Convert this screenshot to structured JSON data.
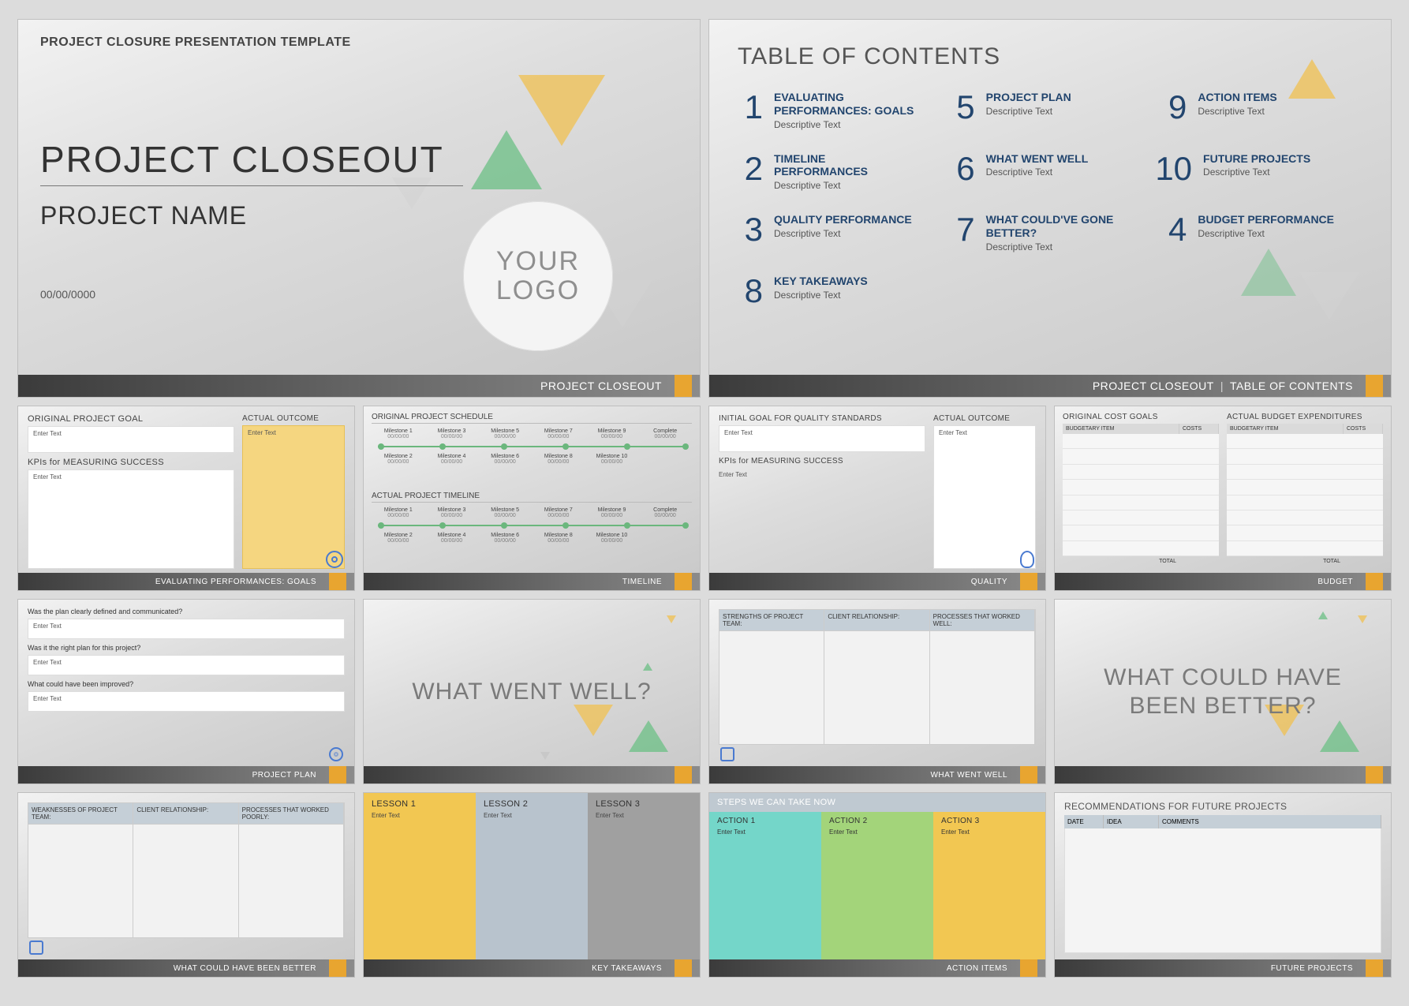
{
  "slide1": {
    "header": "PROJECT CLOSURE PRESENTATION TEMPLATE",
    "title": "PROJECT CLOSEOUT",
    "subtitle": "PROJECT NAME",
    "date": "00/00/0000",
    "logo": "YOUR LOGO",
    "footer": "PROJECT CLOSEOUT"
  },
  "slide2": {
    "title": "TABLE OF CONTENTS",
    "footer_left": "PROJECT CLOSEOUT",
    "footer_sep": "|",
    "footer_right": "TABLE OF CONTENTS",
    "items": [
      {
        "n": "1",
        "t": "EVALUATING PERFORMANCES: GOALS",
        "d": "Descriptive Text"
      },
      {
        "n": "5",
        "t": "PROJECT PLAN",
        "d": "Descriptive Text"
      },
      {
        "n": "9",
        "t": "ACTION ITEMS",
        "d": "Descriptive Text"
      },
      {
        "n": "2",
        "t": "TIMELINE PERFORMANCES",
        "d": "Descriptive Text"
      },
      {
        "n": "6",
        "t": "WHAT WENT WELL",
        "d": "Descriptive Text"
      },
      {
        "n": "10",
        "t": "FUTURE PROJECTS",
        "d": "Descriptive Text"
      },
      {
        "n": "3",
        "t": "QUALITY PERFORMANCE",
        "d": "Descriptive Text"
      },
      {
        "n": "7",
        "t": "WHAT COULD'VE GONE BETTER?",
        "d": "Descriptive Text"
      },
      {
        "n": "4",
        "t": "BUDGET PERFORMANCE",
        "d": "Descriptive Text"
      },
      {
        "n": "8",
        "t": "KEY TAKEAWAYS",
        "d": "Descriptive Text"
      }
    ]
  },
  "slide3": {
    "h1": "ORIGINAL PROJECT GOAL",
    "h2": "ACTUAL OUTCOME",
    "h3": "KPIs for MEASURING SUCCESS",
    "enter": "Enter Text",
    "footer": "EVALUATING PERFORMANCES: GOALS"
  },
  "slide4": {
    "h1": "ORIGINAL PROJECT SCHEDULE",
    "h2": "ACTUAL PROJECT TIMELINE",
    "footer": "TIMELINE",
    "top": [
      "Milestone 1",
      "Milestone 3",
      "Milestone 5",
      "Milestone 7",
      "Milestone 9",
      "Complete"
    ],
    "bot": [
      "Milestone 2",
      "Milestone 4",
      "Milestone 6",
      "Milestone 8",
      "Milestone 10",
      ""
    ],
    "date": "00/00/00"
  },
  "slide5": {
    "h1": "INITIAL GOAL FOR QUALITY STANDARDS",
    "h2": "ACTUAL OUTCOME",
    "h3": "KPIs for MEASURING SUCCESS",
    "enter": "Enter Text",
    "footer": "QUALITY"
  },
  "slide6": {
    "h1": "ORIGINAL COST GOALS",
    "h2": "ACTUAL BUDGET EXPENDITURES",
    "col1": "BUDGETARY ITEM",
    "col2": "COSTS",
    "total": "TOTAL",
    "footer": "BUDGET"
  },
  "slide7": {
    "q1": "Was the plan clearly defined and communicated?",
    "q2": "Was it the right plan for this project?",
    "q3": "What could have been improved?",
    "enter": "Enter Text",
    "footer": "PROJECT PLAN"
  },
  "slide8": {
    "text": "WHAT WENT WELL?"
  },
  "slide9": {
    "c1": "STRENGTHS OF PROJECT TEAM:",
    "c2": "CLIENT RELATIONSHIP:",
    "c3": "PROCESSES THAT WORKED WELL:",
    "footer": "WHAT WENT WELL"
  },
  "slide10": {
    "text": "WHAT COULD HAVE BEEN BETTER?"
  },
  "slide11": {
    "c1": "WEAKNESSES OF PROJECT TEAM:",
    "c2": "CLIENT RELATIONSHIP:",
    "c3": "PROCESSES THAT WORKED POORLY:",
    "footer": "WHAT COULD HAVE BEEN BETTER"
  },
  "slide12": {
    "l1": "LESSON 1",
    "l2": "LESSON 2",
    "l3": "LESSON 3",
    "enter": "Enter Text",
    "footer": "KEY TAKEAWAYS"
  },
  "slide13": {
    "top": "STEPS WE CAN TAKE NOW",
    "a1": "ACTION 1",
    "a2": "ACTION 2",
    "a3": "ACTION 3",
    "enter": "Enter Text",
    "footer": "ACTION ITEMS"
  },
  "slide14": {
    "title": "RECOMMENDATIONS FOR FUTURE PROJECTS",
    "c1": "DATE",
    "c2": "IDEA",
    "c3": "COMMENTS",
    "footer": "FUTURE PROJECTS"
  }
}
